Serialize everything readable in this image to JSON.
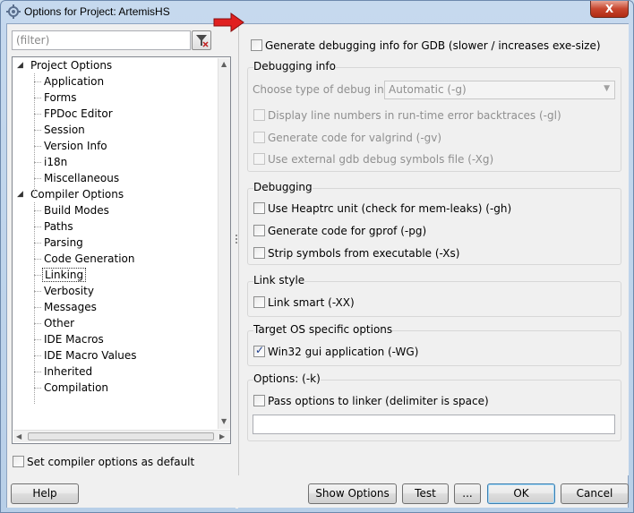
{
  "window": {
    "title": "Options for Project: ArtemisHS",
    "close_label": "X"
  },
  "left": {
    "filter_placeholder": "(filter)",
    "tree": [
      {
        "label": "Project Options",
        "level": 0,
        "expanded": true
      },
      {
        "label": "Application",
        "level": 1
      },
      {
        "label": "Forms",
        "level": 1
      },
      {
        "label": "FPDoc Editor",
        "level": 1
      },
      {
        "label": "Session",
        "level": 1
      },
      {
        "label": "Version Info",
        "level": 1
      },
      {
        "label": "i18n",
        "level": 1
      },
      {
        "label": "Miscellaneous",
        "level": 1
      },
      {
        "label": "Compiler Options",
        "level": 0,
        "expanded": true
      },
      {
        "label": "Build Modes",
        "level": 1
      },
      {
        "label": "Paths",
        "level": 1
      },
      {
        "label": "Parsing",
        "level": 1
      },
      {
        "label": "Code Generation",
        "level": 1
      },
      {
        "label": "Linking",
        "level": 1,
        "selected": true
      },
      {
        "label": "Verbosity",
        "level": 1
      },
      {
        "label": "Messages",
        "level": 1
      },
      {
        "label": "Other",
        "level": 1
      },
      {
        "label": "IDE Macros",
        "level": 1
      },
      {
        "label": "IDE Macro Values",
        "level": 1
      },
      {
        "label": "Inherited",
        "level": 1
      },
      {
        "label": "Compilation",
        "level": 1
      }
    ],
    "set_default_label": "Set compiler options as default",
    "set_default_checked": false
  },
  "right": {
    "gen_debug_label": "Generate debugging info for GDB (slower / increases exe-size)",
    "gen_debug_checked": false,
    "debugging_info": {
      "title": "Debugging info",
      "choose_type_label": "Choose type of debug info",
      "choose_type_value": "Automatic (-g)",
      "options": [
        {
          "label": "Display line numbers in run-time error backtraces (-gl)",
          "checked": false,
          "enabled": false
        },
        {
          "label": "Generate code for valgrind (-gv)",
          "checked": false,
          "enabled": false
        },
        {
          "label": "Use external gdb debug symbols file (-Xg)",
          "checked": false,
          "enabled": false
        }
      ]
    },
    "debugging": {
      "title": "Debugging",
      "options": [
        {
          "label": "Use Heaptrc unit (check for mem-leaks) (-gh)",
          "checked": false
        },
        {
          "label": "Generate code for gprof (-pg)",
          "checked": false
        },
        {
          "label": "Strip symbols from executable (-Xs)",
          "checked": false
        }
      ]
    },
    "link_style": {
      "title": "Link style",
      "options": [
        {
          "label": "Link smart (-XX)",
          "checked": false
        }
      ]
    },
    "target_os": {
      "title": "Target OS specific options",
      "options": [
        {
          "label": "Win32 gui application (-WG)",
          "checked": true
        }
      ]
    },
    "options_k": {
      "title": "Options:  (-k)",
      "pass_label": "Pass options to linker (delimiter is space)",
      "pass_checked": false,
      "value": ""
    }
  },
  "buttons": {
    "help": "Help",
    "show_options": "Show Options",
    "test": "Test",
    "ellipsis": "...",
    "ok": "OK",
    "cancel": "Cancel"
  },
  "colors": {
    "indicator_arrow": "#e02020",
    "selected_outline": "#333333"
  }
}
